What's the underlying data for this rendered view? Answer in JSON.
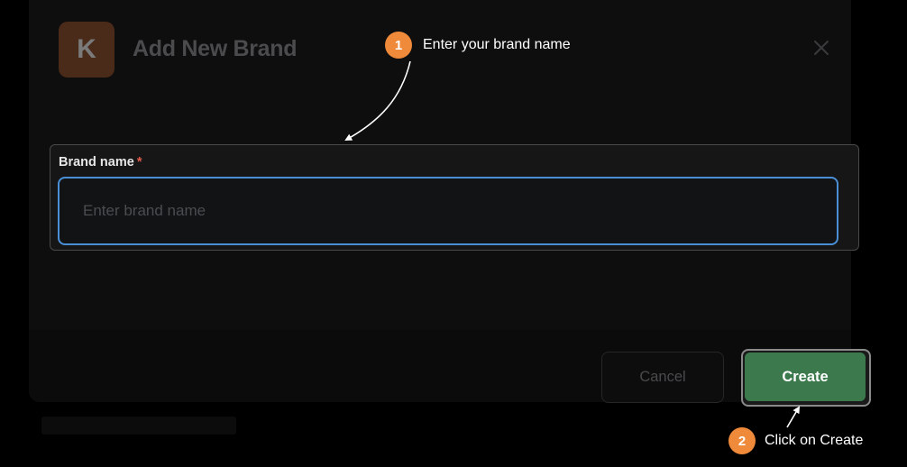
{
  "modal": {
    "logo_letter": "K",
    "title": "Add New Brand",
    "close_label": "close"
  },
  "form": {
    "brand_field": {
      "label": "Brand name",
      "required_mark": "*",
      "placeholder": "Enter brand name",
      "value": ""
    }
  },
  "footer": {
    "cancel_label": "Cancel",
    "create_label": "Create"
  },
  "annotations": [
    {
      "step": "1",
      "text": "Enter your brand name"
    },
    {
      "step": "2",
      "text": "Click on Create"
    }
  ],
  "colors": {
    "accent_green": "#3c7a4e",
    "focus_blue": "#4a8fd6",
    "step_orange": "#ef8a3a",
    "required_red": "#e05a4a",
    "logo_bg": "#4a2a18"
  },
  "icons": {
    "close": "close-icon",
    "arrow": "arrow-icon"
  }
}
